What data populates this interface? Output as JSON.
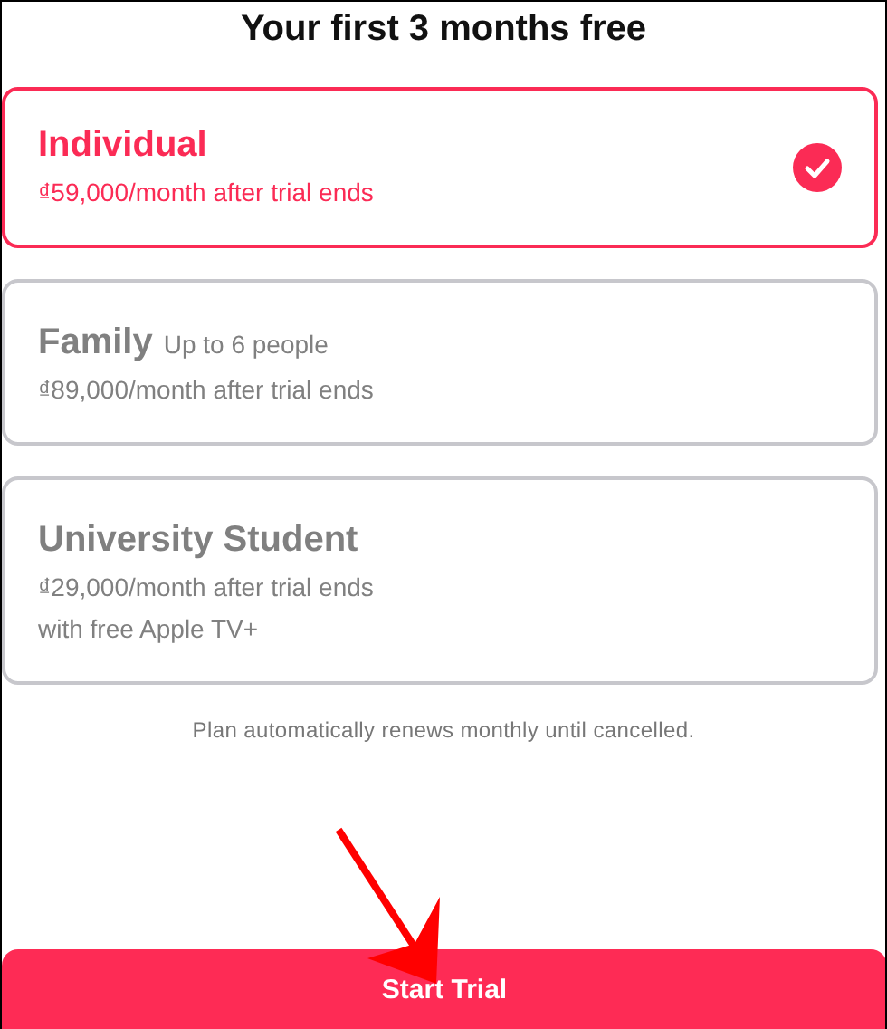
{
  "title": "Your first 3 months free",
  "plans": [
    {
      "name": "Individual",
      "lines": [
        "₫59,000/month after trial ends"
      ],
      "selected": true
    },
    {
      "name": "Family",
      "note": "Up to 6 people",
      "lines": [
        "₫89,000/month after trial ends"
      ],
      "selected": false
    },
    {
      "name": "University Student",
      "lines": [
        "₫29,000/month after trial ends",
        "with free Apple TV+"
      ],
      "selected": false
    }
  ],
  "footnote": "Plan automatically renews monthly until cancelled.",
  "button": "Start Trial"
}
